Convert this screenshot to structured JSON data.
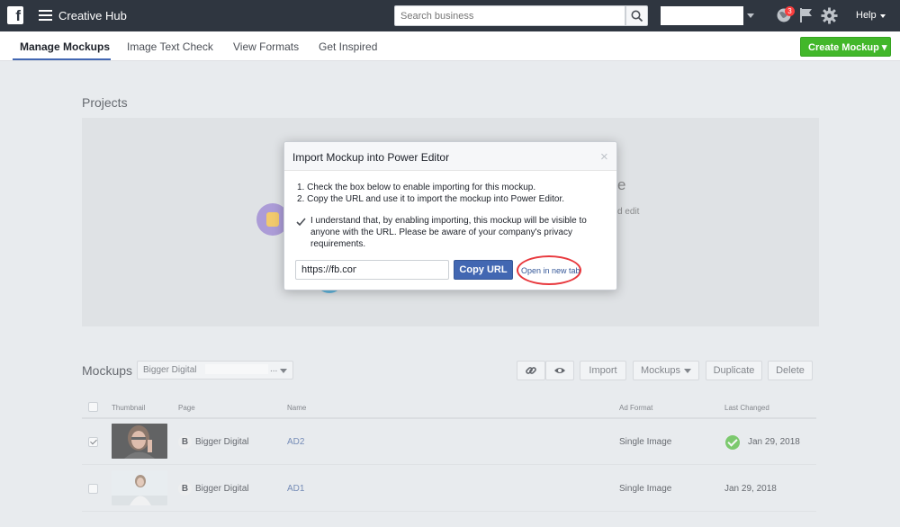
{
  "topbar": {
    "app_title": "Creative Hub",
    "search_placeholder": "Search business",
    "notifications_count": "3",
    "help_label": "Help"
  },
  "subnav": {
    "tabs": [
      {
        "label": "Manage Mockups",
        "active": true
      },
      {
        "label": "Image Text Check",
        "active": false
      },
      {
        "label": "View Formats",
        "active": false
      },
      {
        "label": "Get Inspired",
        "active": false
      }
    ],
    "create_button": "Create Mockup ▾"
  },
  "projects": {
    "title": "Projects",
    "bg_text_1": "e",
    "bg_text_2": "d edit"
  },
  "modal": {
    "title": "Import Mockup into Power Editor",
    "close": "×",
    "step_1": "1. Check the box below to enable importing for this mockup.",
    "step_2": "2. Copy the URL and use it to import the mockup into Power Editor.",
    "consent": "I understand that, by enabling importing, this mockup will be visible to anyone with the URL. Please be aware of your company's privacy requirements.",
    "consent_checked": true,
    "url_value": "https://fb.com/l/",
    "copy_button": "Copy URL",
    "open_link": "Open in new tab"
  },
  "mockups": {
    "title": "Mockups",
    "page_select": "Bigger Digital",
    "page_select_suffix": "...",
    "buttons": {
      "import": "Import",
      "mockups": "Mockups",
      "duplicate": "Duplicate",
      "delete": "Delete"
    },
    "columns": {
      "thumbnail": "Thumbnail",
      "page": "Page",
      "name": "Name",
      "ad_format": "Ad Format",
      "last_changed": "Last Changed"
    },
    "rows": [
      {
        "checked": true,
        "page": "Bigger Digital",
        "page_icon": "B",
        "name": "AD2",
        "ad_format": "Single Image",
        "last_changed": "Jan 29, 2018",
        "status": "ok"
      },
      {
        "checked": false,
        "page": "Bigger Digital",
        "page_icon": "B",
        "name": "AD1",
        "ad_format": "Single Image",
        "last_changed": "Jan 29, 2018",
        "status": ""
      }
    ]
  },
  "colors": {
    "topbar": "#2f3640",
    "primary": "#4267b2",
    "create": "#42b72a",
    "highlight_ring": "#e8383d"
  }
}
